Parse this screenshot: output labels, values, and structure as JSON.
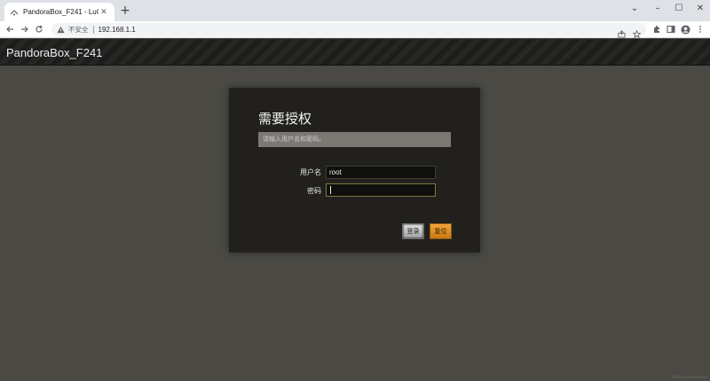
{
  "browser": {
    "tab_title": "PandoraBox_F241 - LuCI",
    "tab_close": "✕",
    "new_tab": "+",
    "insecure_label": "不安全",
    "url": "192.168.1.1",
    "window_controls": [
      "⌄",
      "–",
      "☐",
      "✕"
    ]
  },
  "header": {
    "brand": "PandoraBox_F241"
  },
  "login": {
    "title": "需要授权",
    "notice": "请输入用户名和密码。",
    "username_label": "用户名",
    "username_value": "root",
    "password_label": "密码",
    "password_value": "",
    "login_button": "登录",
    "reset_button": "复位"
  },
  "watermark": "CSDN @xxxxxxxxxx",
  "colors": {
    "background": "#4a4944",
    "panel": "#22201d",
    "reset_accent": "#e0912a"
  }
}
